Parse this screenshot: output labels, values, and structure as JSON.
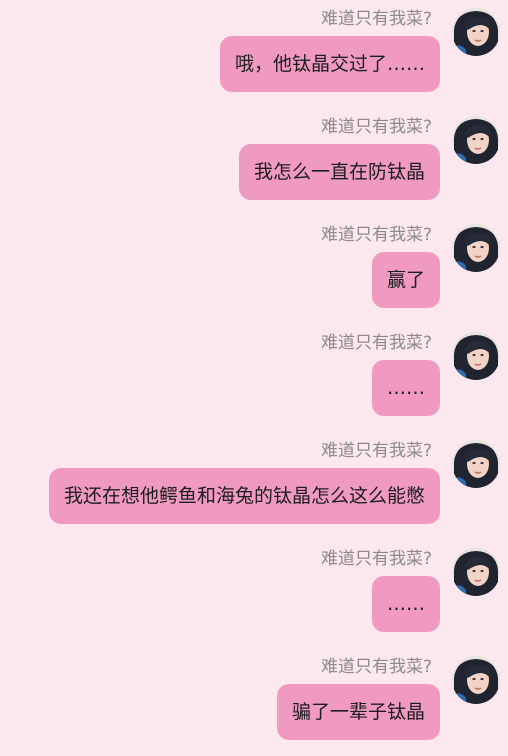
{
  "messages": [
    {
      "name": "难道只有我菜?",
      "text": "哦，他钛晶交过了……",
      "avatar": "person-photo-icon"
    },
    {
      "name": "难道只有我菜?",
      "text": "我怎么一直在防钛晶",
      "avatar": "person-photo-icon"
    },
    {
      "name": "难道只有我菜?",
      "text": "赢了",
      "avatar": "person-photo-icon"
    },
    {
      "name": "难道只有我菜?",
      "text": "……",
      "avatar": "person-photo-icon"
    },
    {
      "name": "难道只有我菜?",
      "text": "我还在想他鳄鱼和海兔的钛晶怎么这么能憋",
      "avatar": "person-photo-icon"
    },
    {
      "name": "难道只有我菜?",
      "text": "……",
      "avatar": "person-photo-icon"
    },
    {
      "name": "难道只有我菜?",
      "text": "骗了一辈子钛晶",
      "avatar": "person-photo-icon"
    }
  ],
  "colors": {
    "background": "#fde8ef",
    "bubble": "#f09ac2",
    "name_text": "#8d8a8c"
  }
}
